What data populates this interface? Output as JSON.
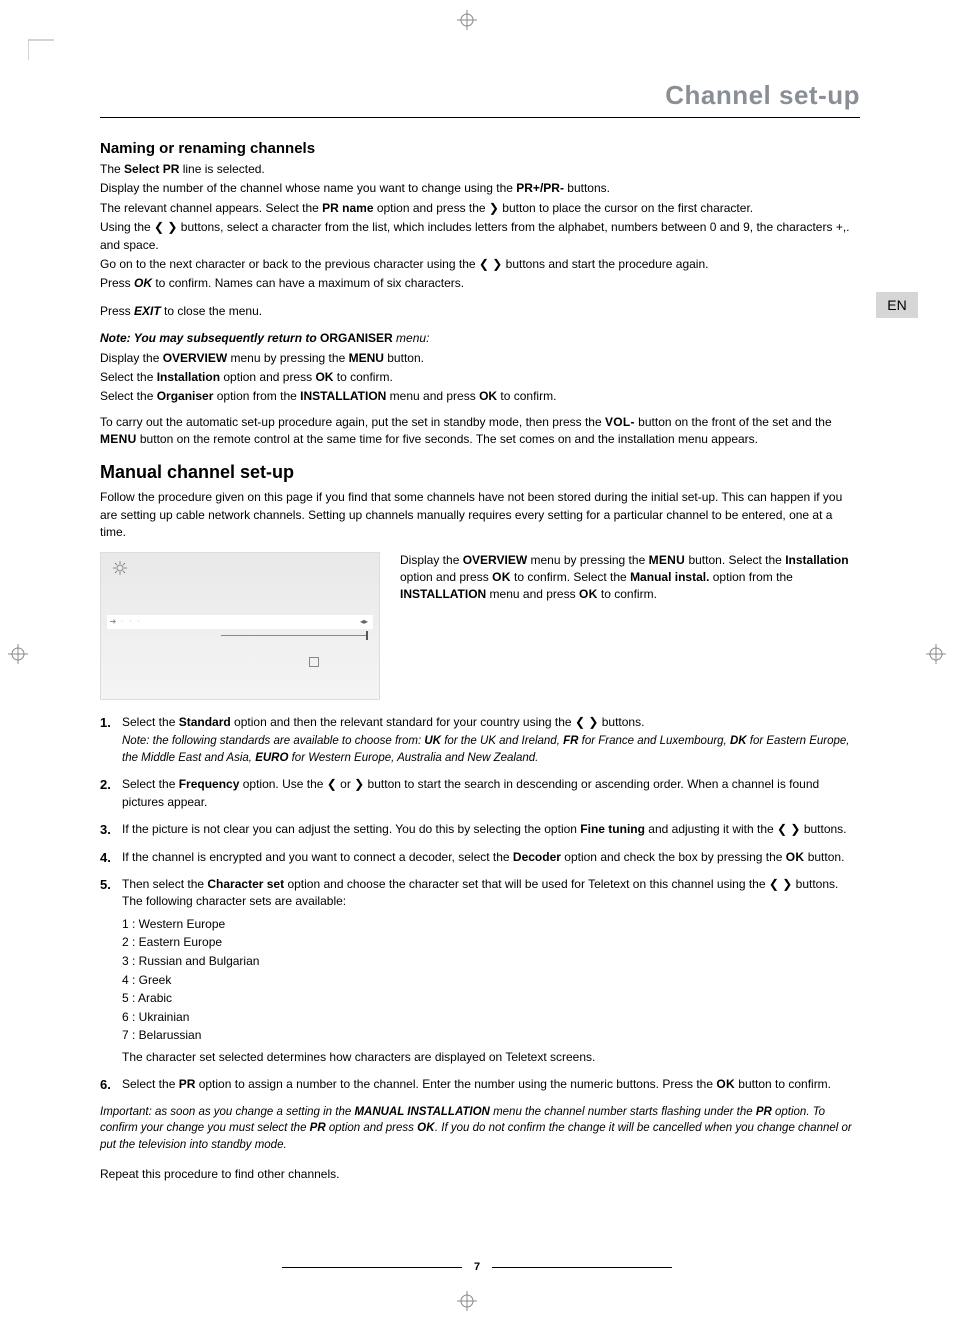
{
  "lang_tab": "EN",
  "header_title": "Channel set-up",
  "section1_heading": "Naming or renaming channels",
  "s1_p1_a": "The ",
  "s1_p1_b": "Select PR",
  "s1_p1_c": " line is selected.",
  "s1_p2_a": "Display the number of the channel whose name you want to change using the ",
  "s1_p2_b": "PR+/PR-",
  "s1_p2_c": " buttons.",
  "s1_p3_a": "The relevant channel appears. Select the ",
  "s1_p3_b": "PR name",
  "s1_p3_c": " option and press the ❯ button to place the cursor on the first character.",
  "s1_p4_a": "Using the ❮ ❯  buttons, select a character from the list, which includes letters from the alphabet, numbers between 0 and 9, the characters +,. and space.",
  "s1_p5_a": "Go on to the next character or back to the previous character using the ❮ ❯ buttons and start the procedure again.",
  "s1_p6_a": "Press ",
  "s1_p6_b": "OK",
  "s1_p6_c": " to confirm. Names can have a maximum of six characters.",
  "s1_p7_a": "Press ",
  "s1_p7_b": "EXIT",
  "s1_p7_c": " to close the menu.",
  "note_intro_a": "Note: You may subsequently return to ",
  "note_intro_b": "ORGANISER",
  "note_intro_c": " menu:",
  "note_l1_a": "Display the ",
  "note_l1_b": "OVERVIEW",
  "note_l1_c": " menu by pressing the ",
  "note_l1_d": "MENU",
  "note_l1_e": " button.",
  "note_l2_a": "Select the ",
  "note_l2_b": "Installation",
  "note_l2_c": " option and press ",
  "note_l2_d": "OK",
  "note_l2_e": " to confirm.",
  "note_l3_a": "Select the ",
  "note_l3_b": "Organiser",
  "note_l3_c": " option from the ",
  "note_l3_d": "INSTALLATION",
  "note_l3_e": " menu and press ",
  "note_l3_f": "OK",
  "note_l3_g": " to confirm.",
  "s1_auto_a": "To carry out the automatic set-up procedure again, put the set in standby mode, then press the ",
  "s1_auto_b": "VOL-",
  "s1_auto_c": " button on the front of the set and the ",
  "s1_auto_d": "MENU",
  "s1_auto_e": " button on the remote control at the same time for five seconds. The set comes on and the installation menu appears.",
  "section2_heading": "Manual channel set-up",
  "s2_intro": "Follow the procedure given on this page if you find that some channels have not been stored during the initial set-up. This can happen if you are setting up cable network channels. Setting up channels manually requires every setting for a particular channel to be entered, one at a time.",
  "side_a": "Display the ",
  "side_b": "OVERVIEW",
  "side_c": " menu by pressing the ",
  "side_d": "MENU",
  "side_e": " button. Select the ",
  "side_f": "Installation",
  "side_g": " option and press ",
  "side_h": "OK",
  "side_i": " to confirm. Select the ",
  "side_j": "Manual instal.",
  "side_k": " option from the ",
  "side_l": "INSTALLATION",
  "side_m": " menu and press ",
  "side_n": "OK",
  "side_o": " to confirm.",
  "step1_a": "Select the ",
  "step1_b": "Standard",
  "step1_c": " option and then the relevant standard for your country using the ❮ ❯ buttons.",
  "step1_note_a": "Note: the following standards are available to choose from: ",
  "step1_uk": "UK",
  "step1_uk_t": " for the UK and Ireland, ",
  "step1_fr": "FR",
  "step1_fr_t": " for France and Luxembourg, ",
  "step1_dk": "DK",
  "step1_dk_t": " for Eastern Europe, the Middle East and Asia, ",
  "step1_eu": "EURO",
  "step1_eu_t": " for Western Europe, Australia and New Zealand.",
  "step2_a": "Select the ",
  "step2_b": "Frequency",
  "step2_c": " option. Use the ❮ or ❯ button to start the search in descending or ascending order. When a channel is found pictures appear.",
  "step3_a": "If the picture is not clear you can adjust the setting. You do this by selecting the option ",
  "step3_b": "Fine tuning",
  "step3_c": " and adjusting it with the ❮ ❯ buttons.",
  "step4_a": "If the channel is encrypted and you want to connect a decoder, select the ",
  "step4_b": "Decoder",
  "step4_c": " option and check the box by pressing the ",
  "step4_d": "OK",
  "step4_e": " button.",
  "step5_a": "Then select the ",
  "step5_b": "Character set",
  "step5_c": " option and choose the character set that will be used for Teletext on this channel using the ❮ ❯ buttons. The following character sets are available:",
  "cs1": "1 : Western Europe",
  "cs2": "2 : Eastern Europe",
  "cs3": "3 : Russian and Bulgarian",
  "cs4": "4 : Greek",
  "cs5": "5 : Arabic",
  "cs6": "6 : Ukrainian",
  "cs7": "7 : Belarussian",
  "cs_tail": "The character set selected determines how characters are displayed on Teletext screens.",
  "step6_a": "Select the ",
  "step6_b": "PR",
  "step6_c": " option to assign a number to the channel. Enter the number using the numeric buttons. Press the ",
  "step6_d": "OK",
  "step6_e": " button to confirm.",
  "important_a": "Important: as soon as you change a setting in the ",
  "important_b": "MANUAL INSTALLATION",
  "important_c": " menu the channel number starts flashing under the ",
  "important_d": "PR",
  "important_e": " option. To confirm your change you must select the ",
  "important_f": "PR",
  "important_g": " option and press ",
  "important_h": "OK",
  "important_i": ". If you do not confirm the change it will be cancelled when you change channel or put the television into standby mode.",
  "repeat": "Repeat this procedure to find other channels.",
  "page_number": "7"
}
